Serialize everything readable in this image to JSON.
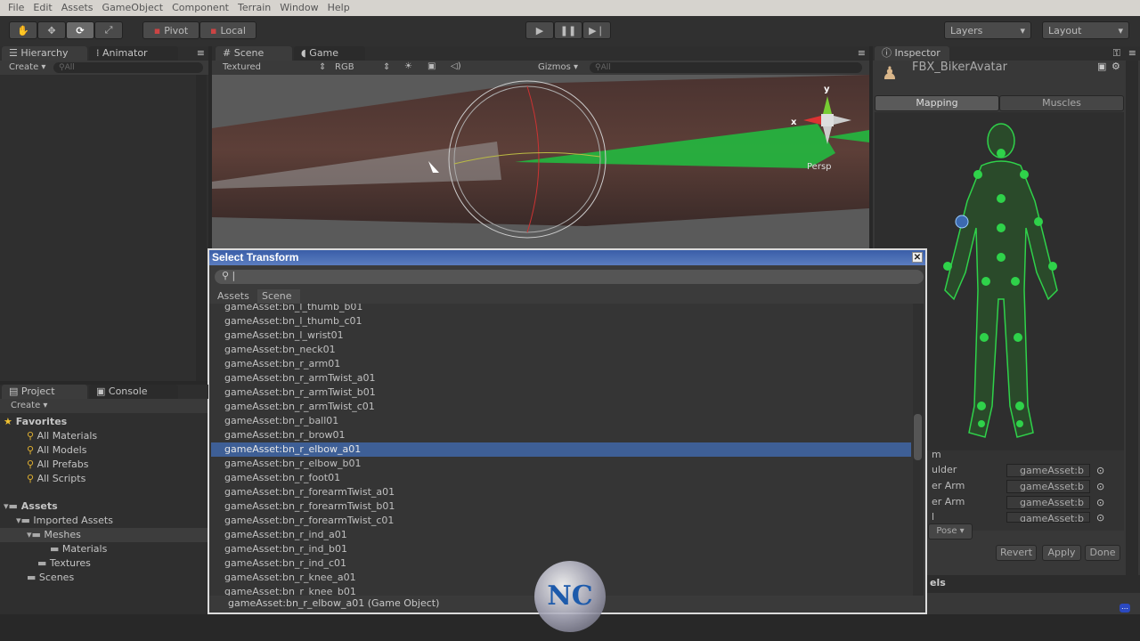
{
  "menu": [
    "File",
    "Edit",
    "Assets",
    "GameObject",
    "Component",
    "Terrain",
    "Window",
    "Help"
  ],
  "toolbar": {
    "pivot": "Pivot",
    "local": "Local",
    "layers": "Layers",
    "layout": "Layout"
  },
  "hierarchy": {
    "tab": "Hierarchy",
    "tab2": "Animator",
    "create": "Create",
    "search": "All"
  },
  "scene": {
    "tab": "Scene",
    "tab2": "Game",
    "shading": "Textured",
    "render": "RGB",
    "gizmos": "Gizmos",
    "search": "All",
    "persp": "Persp",
    "axis_y": "y",
    "axis_x": "x"
  },
  "project": {
    "tab": "Project",
    "tab2": "Console",
    "create": "Create",
    "favorites": "Favorites",
    "fav_items": [
      "All Materials",
      "All Models",
      "All Prefabs",
      "All Scripts"
    ],
    "assets": "Assets",
    "imported": "Imported Assets",
    "meshes": "Meshes",
    "materials": "Materials",
    "textures": "Textures",
    "scenes": "Scenes"
  },
  "inspector": {
    "tab": "Inspector",
    "object": "FBX_BikerAvatar",
    "mapping": "Mapping",
    "muscles": "Muscles",
    "labels": [
      "m",
      "ulder",
      "er Arm",
      "er Arm",
      "l"
    ],
    "fields": [
      "gameAsset:b",
      "gameAsset:b",
      "gameAsset:b",
      "gameAsset:b"
    ],
    "pose": "Pose",
    "revert": "Revert",
    "apply": "Apply",
    "done": "Done",
    "section": "els",
    "side_labels": [
      "d",
      "nd"
    ]
  },
  "dialog": {
    "title": "Select Transform",
    "search": "",
    "tabs": [
      "Assets",
      "Scene"
    ],
    "items": [
      "gameAsset:bn_l_thumb_b01",
      "gameAsset:bn_l_thumb_c01",
      "gameAsset:bn_l_wrist01",
      "gameAsset:bn_neck01",
      "gameAsset:bn_r_arm01",
      "gameAsset:bn_r_armTwist_a01",
      "gameAsset:bn_r_armTwist_b01",
      "gameAsset:bn_r_armTwist_c01",
      "gameAsset:bn_r_ball01",
      "gameAsset:bn_r_brow01",
      "gameAsset:bn_r_elbow_a01",
      "gameAsset:bn_r_elbow_b01",
      "gameAsset:bn_r_foot01",
      "gameAsset:bn_r_forearmTwist_a01",
      "gameAsset:bn_r_forearmTwist_b01",
      "gameAsset:bn_r_forearmTwist_c01",
      "gameAsset:bn_r_ind_a01",
      "gameAsset:bn_r_ind_b01",
      "gameAsset:bn_r_ind_c01",
      "gameAsset:bn_r_knee_a01",
      "gameAsset:bn_r_knee_b01"
    ],
    "selected_index": 10,
    "status": "gameAsset:bn_r_elbow_a01 (Game Object)"
  },
  "colors": {
    "selection": "#3e5f96",
    "bone_green": "#2fd24a",
    "title_blue": "#3a5ea8"
  }
}
